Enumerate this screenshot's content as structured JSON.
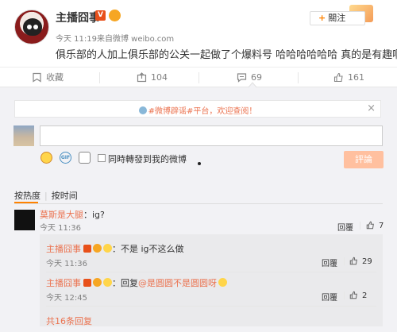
{
  "post": {
    "user_name": "主播囧事",
    "vip_mark": "V",
    "follow_label": "關注",
    "meta": "今天 11:19来自微博 weibo.com",
    "text": "俱乐部的人加上俱乐部的公关一起做了个爆料号 哈哈哈哈哈哈 真的是有趣啊"
  },
  "actions": {
    "collect": "收藏",
    "share": "104",
    "comment": "69",
    "like": "161"
  },
  "comment_box": {
    "notice": "#微博辟谣#平台，欢迎查阅！",
    "close": "×",
    "gif": "GIF",
    "repost_label": "同時轉發到我的微博",
    "submit": "評論"
  },
  "sort": {
    "hot": "按热度",
    "time": "按时间"
  },
  "comments": [
    {
      "author": "莫斯是大腿",
      "text": "：ig?",
      "time": "今天 11:36",
      "reply_label": "回覆",
      "likes": "7"
    }
  ],
  "replies": [
    {
      "author": "主播囧事",
      "text": "：不是 ig不这么做",
      "time": "今天 11:36",
      "reply_label": "回覆",
      "likes": "29"
    },
    {
      "author": "主播囧事",
      "text_prefix": "：回复",
      "mention": "@是圆圆不是圆圆呀",
      "time": "今天 12:45",
      "reply_label": "回覆",
      "likes": "2"
    }
  ],
  "more_replies": "共16条回复",
  "colors": {
    "accent": "#ff8200",
    "name_link": "#eb7350",
    "panel_bg": "#f2f2f5",
    "submit_disabled": "#ffc09f"
  },
  "icons": [
    "emoji-icon",
    "gif-icon",
    "image-icon",
    "collect-icon",
    "share-icon",
    "comment-icon",
    "like-icon",
    "close-icon",
    "info-icon"
  ]
}
